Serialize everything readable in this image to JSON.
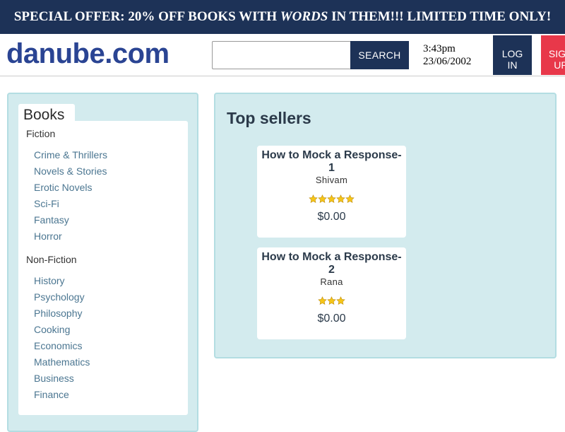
{
  "banner": {
    "prefix": "SPECIAL OFFER: 20% OFF BOOKS WITH ",
    "emphasis": "WORDS",
    "suffix": " IN THEM!!! LIMITED TIME ONLY!"
  },
  "header": {
    "logo": "danube.com",
    "search_placeholder": "",
    "search_label": "SEARCH",
    "time": "3:43pm",
    "date": "23/06/2002",
    "login_label": "LOG\nIN",
    "signup_label": "SIGN\nUP"
  },
  "sidebar": {
    "tab_label": "Books",
    "fiction_heading": "Fiction",
    "fiction": [
      "Crime & Thrillers",
      "Novels & Stories",
      "Erotic Novels",
      "Sci-Fi",
      "Fantasy",
      "Horror"
    ],
    "nonfiction_heading": "Non-Fiction",
    "nonfiction": [
      "History",
      "Psychology",
      "Philosophy",
      "Cooking",
      "Economics",
      "Mathematics",
      "Business",
      "Finance"
    ]
  },
  "main": {
    "title": "Top sellers",
    "books": [
      {
        "title": "How to Mock a Response-1",
        "author": "Shivam",
        "rating": 5,
        "price": "$0.00"
      },
      {
        "title": "How to Mock a Response-2",
        "author": "Rana",
        "rating": 3,
        "price": "$0.00"
      }
    ]
  },
  "colors": {
    "navy": "#1d3257",
    "logo_blue": "#2a4493",
    "signup_red": "#e8384a",
    "panel_bg": "#d3ebee",
    "link_blue": "#4b7691",
    "star_gold": "#f5c518"
  },
  "icons": {
    "rating": "star-icon"
  }
}
